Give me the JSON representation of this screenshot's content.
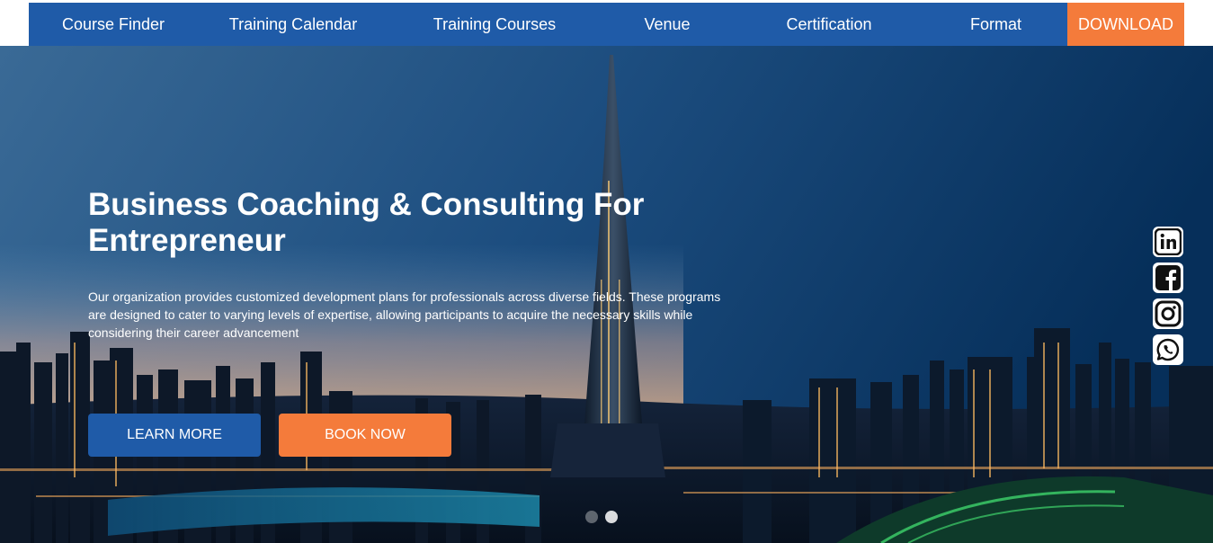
{
  "nav": {
    "items": [
      {
        "label": "Course Finder"
      },
      {
        "label": "Training Calendar"
      },
      {
        "label": "Training Courses"
      },
      {
        "label": "Venue"
      },
      {
        "label": "Certification"
      },
      {
        "label": "Format"
      }
    ],
    "download_label": "DOWNLOAD"
  },
  "hero": {
    "title": "Business Coaching & Consulting For Entrepreneur",
    "description": "Our organization provides customized development plans for professionals across diverse fields. These programs are designed to cater to varying levels of expertise, allowing participants to acquire the necessary skills while considering their career advancement",
    "learn_more_label": "LEARN MORE",
    "book_now_label": "BOOK NOW",
    "slides": {
      "count": 2,
      "active_index": 1
    }
  },
  "social": [
    "linkedin-icon",
    "facebook-icon",
    "instagram-icon",
    "whatsapp-icon"
  ],
  "colors": {
    "brand_blue": "#1f5ba8",
    "accent_orange": "#f47b3b",
    "white": "#ffffff"
  }
}
